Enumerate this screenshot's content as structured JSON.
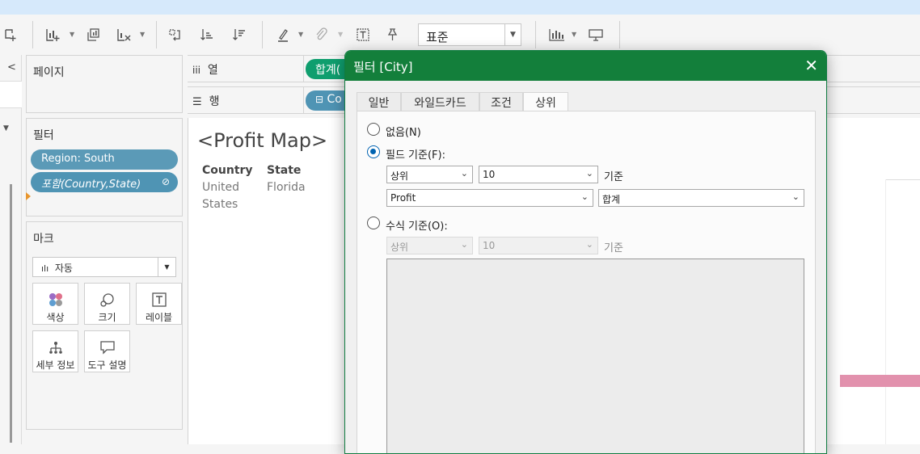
{
  "toolbar": {
    "fit_value": "표준",
    "icons": [
      "new-datasource-icon",
      "new-worksheet-icon",
      "duplicate-sheet-icon",
      "clear-sheet-icon",
      "swap-icon",
      "sort-ascending-icon",
      "sort-descending-icon",
      "highlight-icon",
      "attach-icon",
      "label-text-icon",
      "pin-icon",
      "show-me-icon",
      "presentation-icon"
    ]
  },
  "panels": {
    "pages_title": "페이지",
    "filters_title": "필터",
    "filters": [
      {
        "label": "Region: South"
      },
      {
        "label": "포함(Country,State)"
      }
    ],
    "marks_title": "마크",
    "marks_type": "자동",
    "mark_cards": [
      {
        "label": "색상",
        "icon": "color-icon"
      },
      {
        "label": "크기",
        "icon": "size-icon"
      },
      {
        "label": "레이블",
        "icon": "label-icon"
      },
      {
        "label": "세부 정보",
        "icon": "detail-icon"
      },
      {
        "label": "도구 설명",
        "icon": "tooltip-icon"
      }
    ]
  },
  "shelves": {
    "columns_label": "열",
    "rows_label": "행",
    "columns_pill": "합계(",
    "rows_pill": "Co"
  },
  "view": {
    "title": "<Profit Map>",
    "headers": [
      "Country",
      "State"
    ],
    "row": {
      "country_line1": "United",
      "country_line2": "States",
      "state": "Florida"
    }
  },
  "colors": {
    "dialog_header": "#137f3b",
    "pill_blue": "#5b9ab7",
    "pill_green": "#0f9e6e",
    "radio_on": "#0063b1",
    "bar_pink": "#e291ad"
  },
  "dialog": {
    "title": "필터 [City]",
    "tabs": [
      "일반",
      "와일드카드",
      "조건",
      "상위"
    ],
    "active_tab": "상위",
    "option_none": "없음(N)",
    "option_field": "필드 기준(F):",
    "field_topbottom": "상위",
    "field_count": "10",
    "field_by": "기준",
    "field_name": "Profit",
    "field_agg": "합계",
    "option_formula": "수식 기준(O):",
    "formula_topbottom": "상위",
    "formula_count": "10",
    "formula_by": "기준"
  }
}
